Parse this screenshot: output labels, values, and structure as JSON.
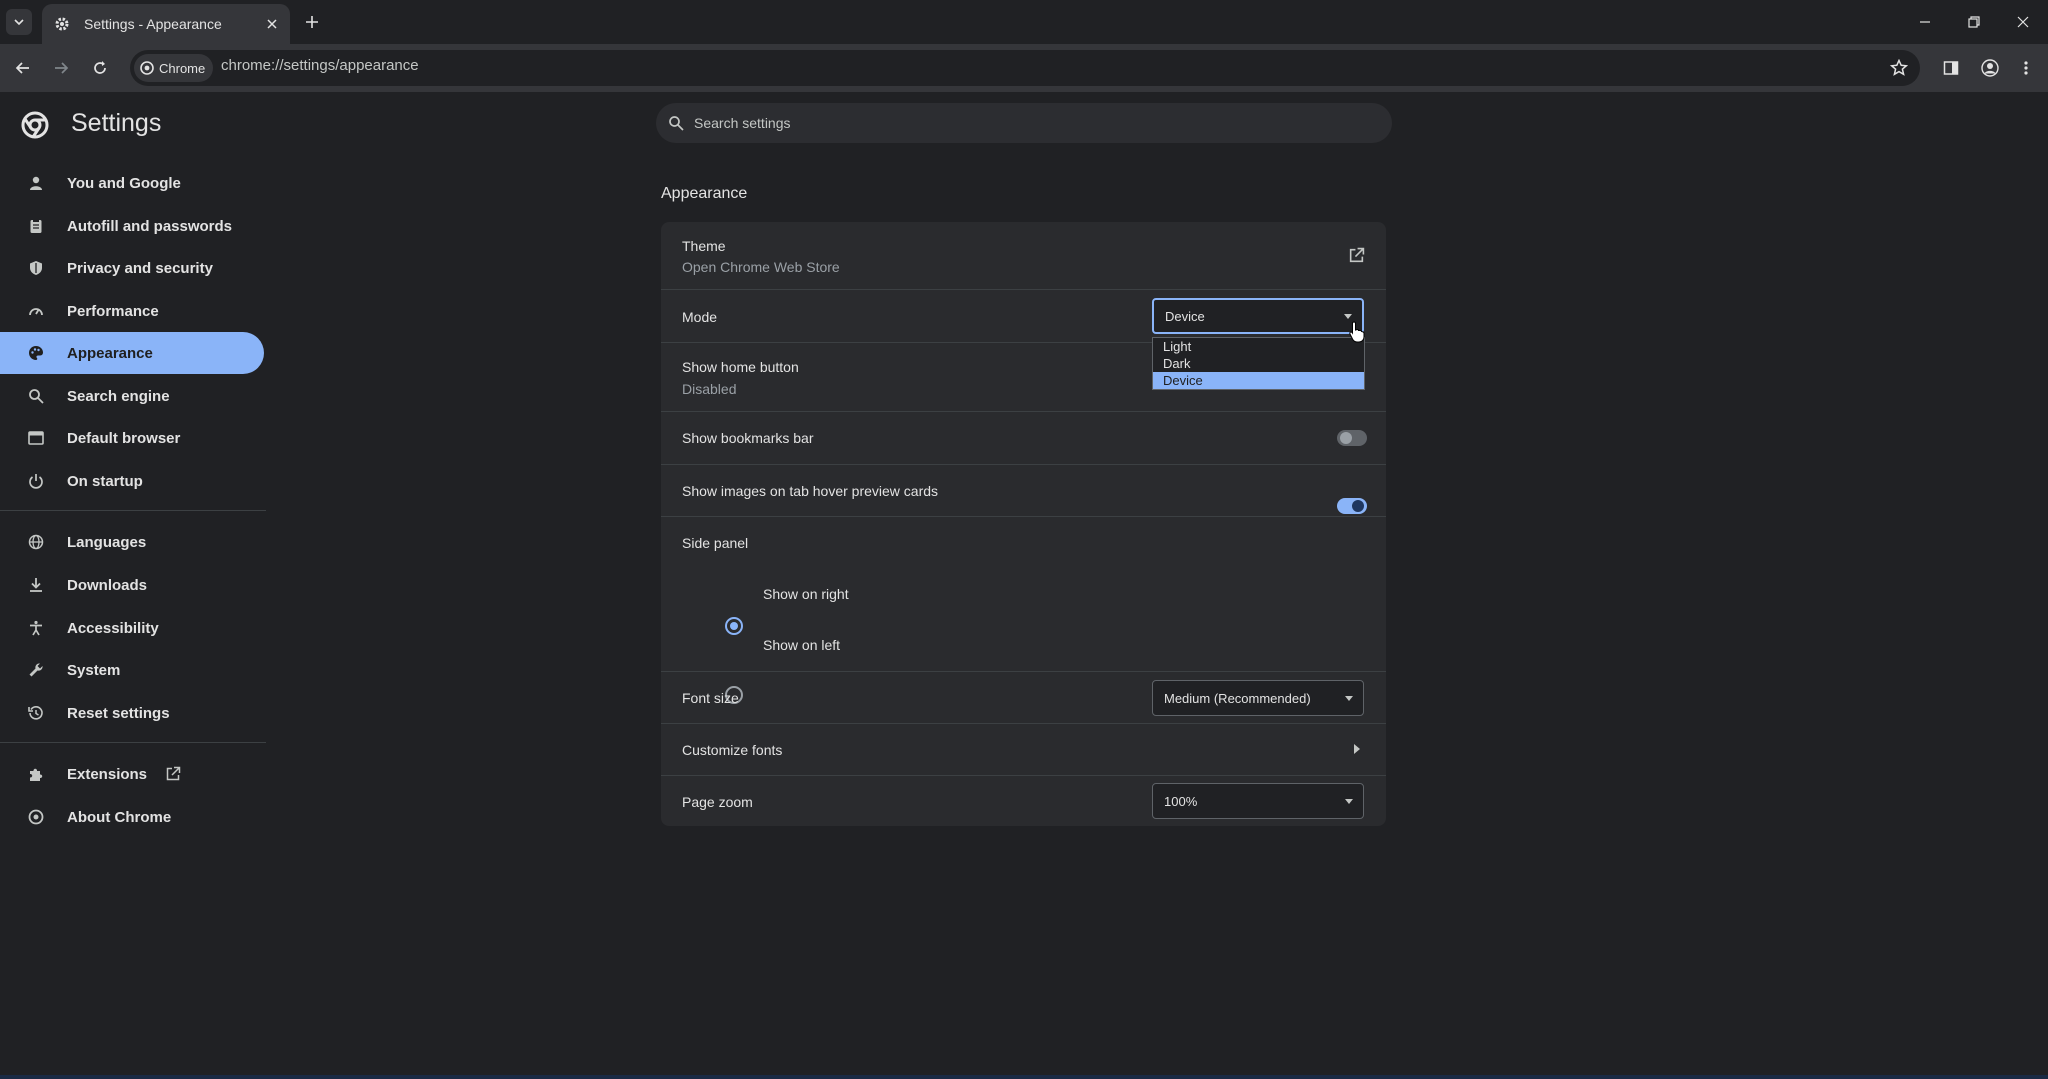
{
  "browser": {
    "tab_title": "Settings - Appearance",
    "omnibox_chip": "Chrome",
    "url": "chrome://settings/appearance"
  },
  "settings": {
    "title": "Settings",
    "search_placeholder": "Search settings",
    "nav": [
      {
        "label": "You and Google",
        "icon": "person-icon",
        "active": false
      },
      {
        "label": "Autofill and passwords",
        "icon": "clipboard-icon",
        "active": false
      },
      {
        "label": "Privacy and security",
        "icon": "shield-icon",
        "active": false
      },
      {
        "label": "Performance",
        "icon": "speedometer-icon",
        "active": false
      },
      {
        "label": "Appearance",
        "icon": "palette-icon",
        "active": true
      },
      {
        "label": "Search engine",
        "icon": "search-icon",
        "active": false
      },
      {
        "label": "Default browser",
        "icon": "browser-window-icon",
        "active": false
      },
      {
        "label": "On startup",
        "icon": "power-icon",
        "active": false
      },
      {
        "label": "Languages",
        "icon": "globe-icon",
        "active": false
      },
      {
        "label": "Downloads",
        "icon": "download-icon",
        "active": false
      },
      {
        "label": "Accessibility",
        "icon": "accessibility-icon",
        "active": false
      },
      {
        "label": "System",
        "icon": "wrench-icon",
        "active": false
      },
      {
        "label": "Reset settings",
        "icon": "history-icon",
        "active": false
      },
      {
        "label": "Extensions",
        "icon": "puzzle-icon",
        "active": false
      },
      {
        "label": "About Chrome",
        "icon": "chrome-logo-icon",
        "active": false
      }
    ]
  },
  "appearance": {
    "heading": "Appearance",
    "theme": {
      "label": "Theme",
      "sublabel": "Open Chrome Web Store"
    },
    "mode": {
      "label": "Mode",
      "value": "Device",
      "options": [
        "Light",
        "Dark",
        "Device"
      ],
      "selected": "Device"
    },
    "home_button": {
      "label": "Show home button",
      "sublabel": "Disabled"
    },
    "bookmarks_bar": {
      "label": "Show bookmarks bar",
      "enabled": false
    },
    "tab_hover_images": {
      "label": "Show images on tab hover preview cards",
      "enabled": true
    },
    "side_panel": {
      "label": "Side panel",
      "options": [
        "Show on right",
        "Show on left"
      ],
      "selected": "Show on right"
    },
    "font_size": {
      "label": "Font size",
      "value": "Medium (Recommended)"
    },
    "customize_fonts": {
      "label": "Customize fonts"
    },
    "page_zoom": {
      "label": "Page zoom",
      "value": "100%"
    }
  },
  "colors": {
    "accent": "#8ab4f8",
    "background": "#202124",
    "card": "#2a2b2e",
    "toolbar": "#35363a"
  }
}
